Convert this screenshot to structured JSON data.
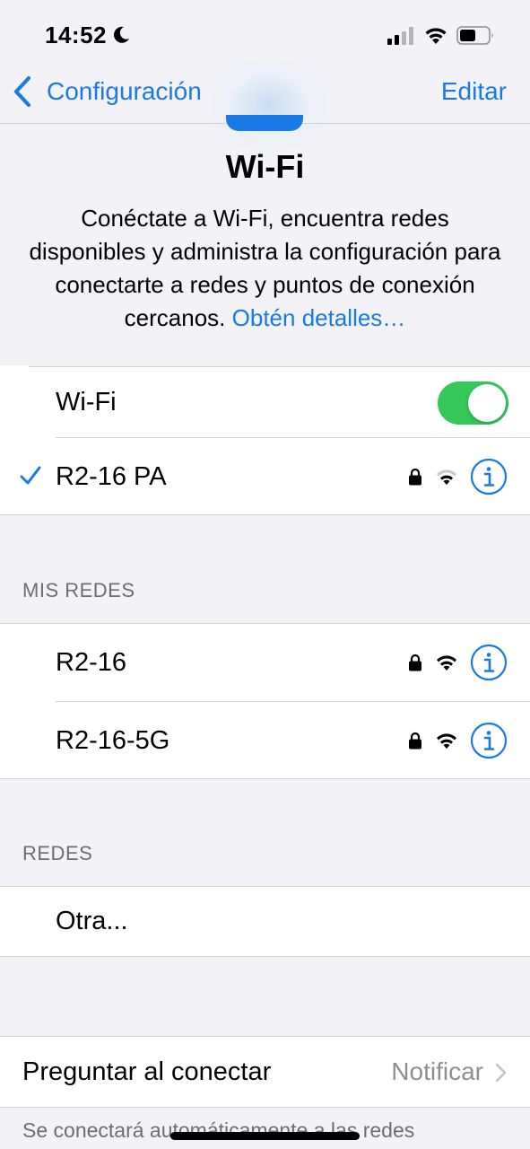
{
  "status_bar": {
    "time": "14:52"
  },
  "nav": {
    "back_label": "Configuración",
    "edit_label": "Editar"
  },
  "header": {
    "title": "Wi-Fi",
    "description": "Conéctate a Wi-Fi, encuentra redes disponibles y administra la configuración para conectarte a redes y puntos de conexión cercanos.",
    "link": "Obtén detalles…"
  },
  "wifi_toggle": {
    "label": "Wi-Fi",
    "enabled": true
  },
  "connected_network": {
    "name": "R2-16 PA",
    "secured": true
  },
  "my_networks": {
    "header": "MIS REDES",
    "items": [
      {
        "name": "R2-16",
        "secured": true
      },
      {
        "name": "R2-16-5G",
        "secured": true
      }
    ]
  },
  "networks": {
    "header": "REDES",
    "other_label": "Otra..."
  },
  "ask_to_join": {
    "label": "Preguntar al conectar",
    "value": "Notificar"
  },
  "footer_note": "Se conectará automáticamente a las redes",
  "colors": {
    "accent": "#1a7ae5",
    "toggle_on": "#34c759",
    "secondary_text": "#6d6d72",
    "background": "#f2f2f7"
  }
}
